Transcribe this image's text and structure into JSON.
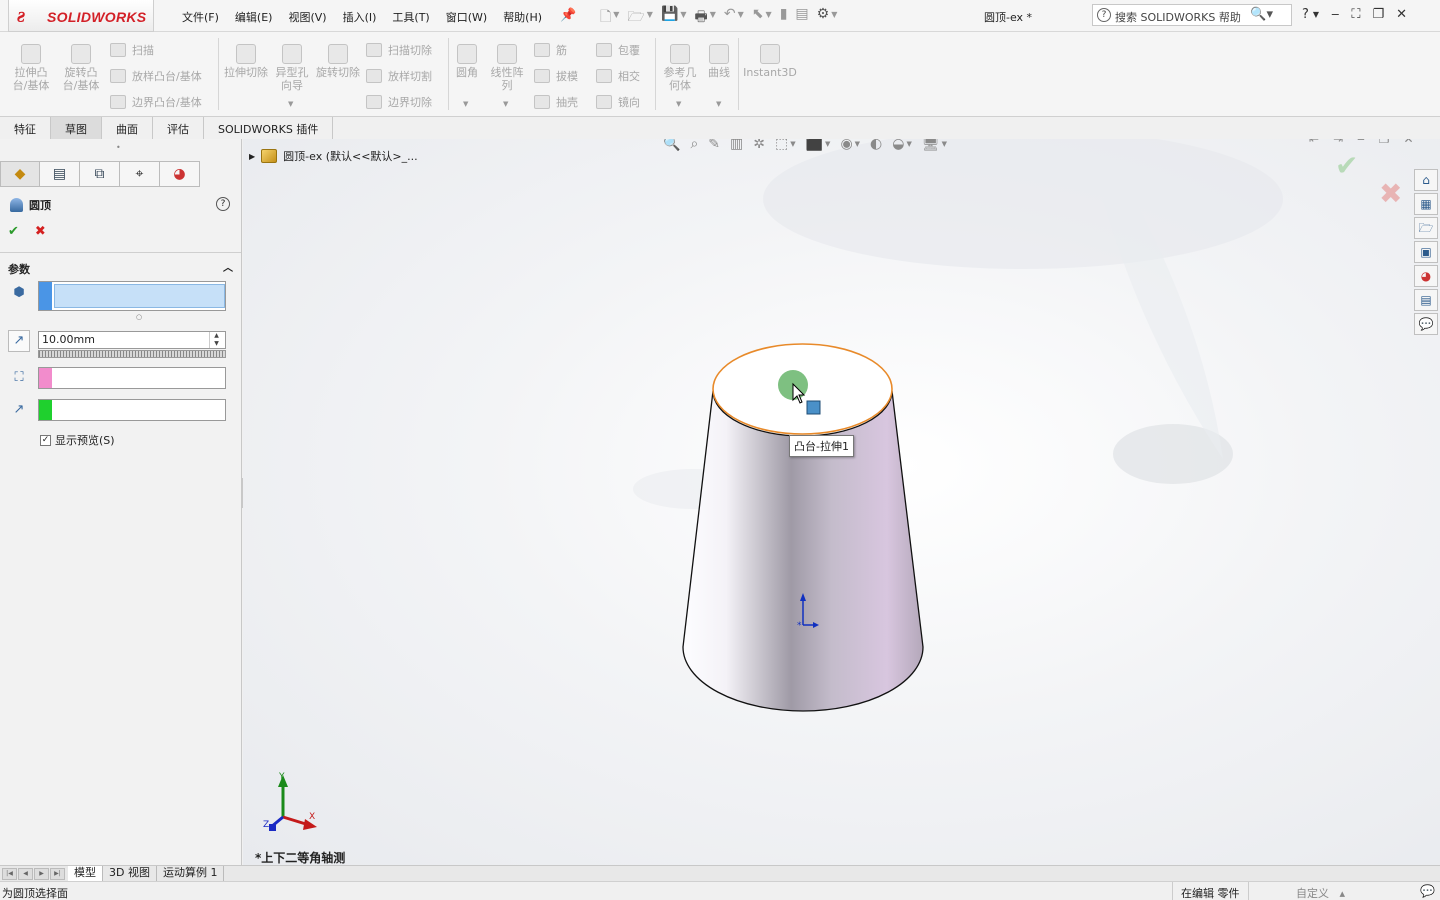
{
  "app": {
    "logo_text": "SOLIDWORKS",
    "document_title": "圆顶-ex *"
  },
  "menu": [
    "文件(F)",
    "编辑(E)",
    "视图(V)",
    "插入(I)",
    "工具(T)",
    "窗口(W)",
    "帮助(H)"
  ],
  "search": {
    "label": "搜索 SOLIDWORKS 帮助"
  },
  "help_menu": "?",
  "command_manager": {
    "extrude_boss": "拉伸凸台/基体",
    "revolve_boss": "旋转凸台/基体",
    "sweep": "扫描",
    "loft_boss": "放样凸台/基体",
    "boundary_boss": "边界凸台/基体",
    "extrude_cut": "拉伸切除",
    "hole_wizard": "异型孔向导",
    "revolve_cut": "旋转切除",
    "sweep_cut": "扫描切除",
    "loft_cut": "放样切割",
    "boundary_cut": "边界切除",
    "fillet": "圆角",
    "linear_pattern": "线性阵列",
    "rib": "筋",
    "draft": "拔模",
    "shell": "抽壳",
    "wrap": "包覆",
    "intersect": "相交",
    "mirror": "镜向",
    "ref_geometry": "参考几何体",
    "curves": "曲线",
    "instant3d": "Instant3D"
  },
  "tabs": [
    "特征",
    "草图",
    "曲面",
    "评估",
    "SOLIDWORKS 插件"
  ],
  "active_tab": "草图",
  "property_manager": {
    "feature_name": "圆顶",
    "ok": "✔",
    "cancel": "✖",
    "section": "参数",
    "distance_value": "10.00mm",
    "show_preview_label": "显示预览(S)",
    "show_preview_checked": true,
    "colors": {
      "face_select": "#4a95e6",
      "constraint": "#f28ccc",
      "direction": "#1fd02e"
    }
  },
  "feature_tree": {
    "root_label": "圆顶-ex  (默认<<默认>_..."
  },
  "viewport": {
    "tooltip": "凸台-拉伸1",
    "view_orientation": "*上下二等角轴测",
    "triad": {
      "x": "X",
      "y": "Y",
      "z": "Z"
    },
    "highlight_color": "#ff8c00"
  },
  "bottom_tabs": [
    "模型",
    "3D 视图",
    "运动算例 1"
  ],
  "status": {
    "message": "为圆顶选择面",
    "editing": "在编辑 零件",
    "units": "自定义"
  }
}
